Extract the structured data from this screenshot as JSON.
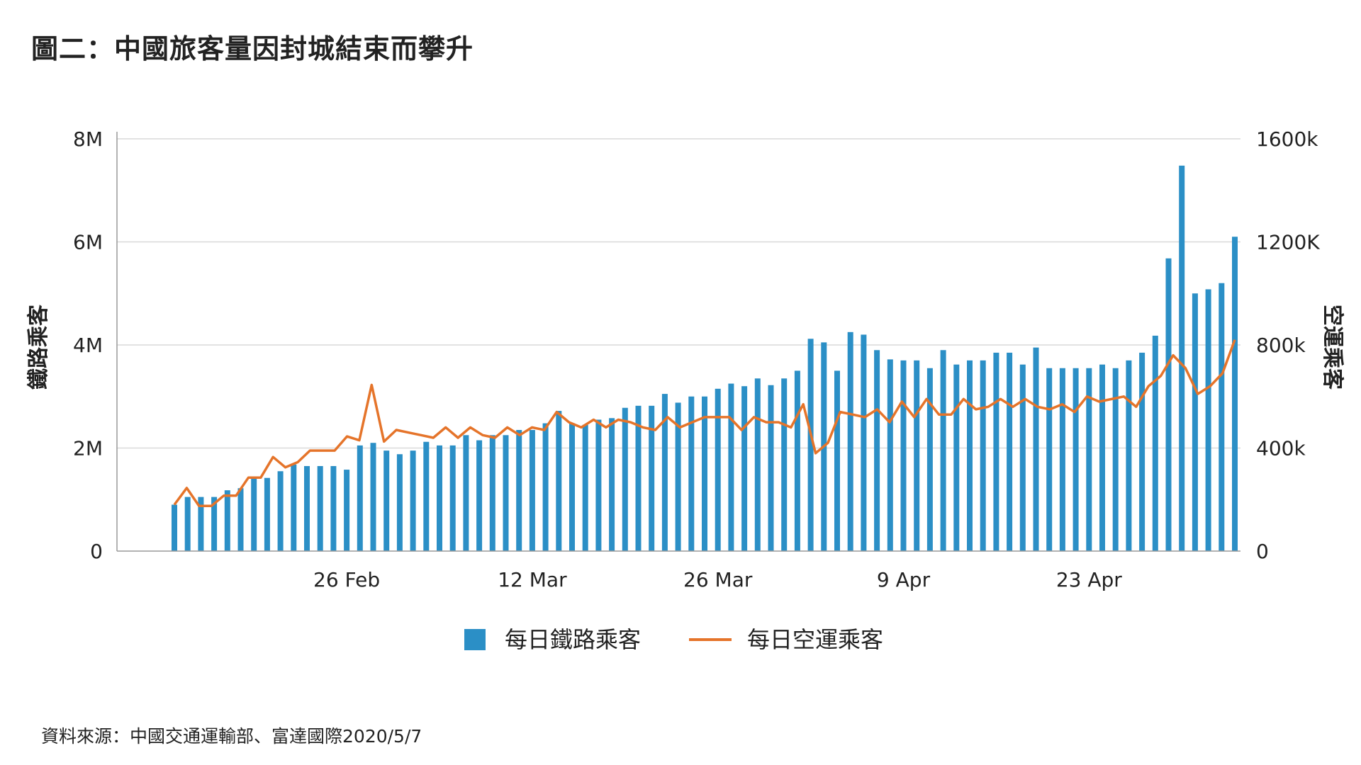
{
  "title": "圖二：中國旅客量因封城結束而攀升",
  "source": "資料來源：中國交通運輸部、富達國際2020/5/7",
  "colors": {
    "rail": "#2b8fc6",
    "air": "#e5742a",
    "grid": "#d9d9d9",
    "axis": "#999999"
  },
  "chart_data": {
    "type": "bar",
    "title": "圖二：中國旅客量因封城結束而攀升",
    "x_tick_labels": [
      "26 Feb",
      "12 Mar",
      "26 Mar",
      "9 Apr",
      "23 Apr"
    ],
    "x_tick_day_index": [
      13,
      27,
      41,
      55,
      69
    ],
    "y_left": {
      "label": "鐵路乘客",
      "ticks": [
        "0",
        "2M",
        "4M",
        "6M",
        "8M"
      ],
      "ylim": [
        0,
        8
      ]
    },
    "y_right": {
      "label": "空運乘客",
      "ticks": [
        "0",
        "400k",
        "800k",
        "1200K",
        "1600k"
      ],
      "ylim": [
        0,
        1600
      ]
    },
    "legend_position": "bottom",
    "series": [
      {
        "name": "每日鐵路乘客",
        "type": "bar",
        "axis": "left",
        "unit": "M",
        "values": [
          0.9,
          1.05,
          1.05,
          1.05,
          1.18,
          1.22,
          1.42,
          1.42,
          1.55,
          1.68,
          1.65,
          1.65,
          1.65,
          1.58,
          2.05,
          2.1,
          1.95,
          1.88,
          1.95,
          2.12,
          2.05,
          2.05,
          2.25,
          2.15,
          2.25,
          2.25,
          2.35,
          2.35,
          2.48,
          2.72,
          2.48,
          2.45,
          2.55,
          2.58,
          2.78,
          2.82,
          2.82,
          3.05,
          2.88,
          3.0,
          3.0,
          3.15,
          3.25,
          3.2,
          3.35,
          3.22,
          3.35,
          3.5,
          4.12,
          4.05,
          3.5,
          4.25,
          4.2,
          3.9,
          3.72,
          3.7,
          3.7,
          3.55,
          3.9,
          3.62,
          3.7,
          3.7,
          3.85,
          3.85,
          3.62,
          3.95,
          3.55,
          3.55,
          3.55,
          3.55,
          3.62,
          3.55,
          3.7,
          3.85,
          4.18,
          5.68,
          7.48,
          5.0,
          5.08,
          5.2,
          6.1
        ]
      },
      {
        "name": "每日空運乘客",
        "type": "line",
        "axis": "right",
        "unit": "k",
        "values": [
          180,
          245,
          175,
          175,
          215,
          215,
          285,
          285,
          365,
          325,
          345,
          390,
          390,
          390,
          445,
          430,
          645,
          425,
          470,
          460,
          450,
          440,
          480,
          440,
          480,
          450,
          440,
          480,
          450,
          480,
          470,
          540,
          500,
          480,
          510,
          480,
          510,
          500,
          480,
          470,
          520,
          480,
          500,
          520,
          520,
          520,
          470,
          520,
          500,
          500,
          480,
          570,
          380,
          420,
          540,
          530,
          520,
          550,
          500,
          580,
          520,
          590,
          530,
          530,
          590,
          550,
          560,
          590,
          560,
          590,
          560,
          550,
          570,
          540,
          600,
          580,
          590,
          600,
          560,
          640,
          680,
          760,
          710,
          610,
          640,
          690,
          820
        ]
      }
    ]
  }
}
